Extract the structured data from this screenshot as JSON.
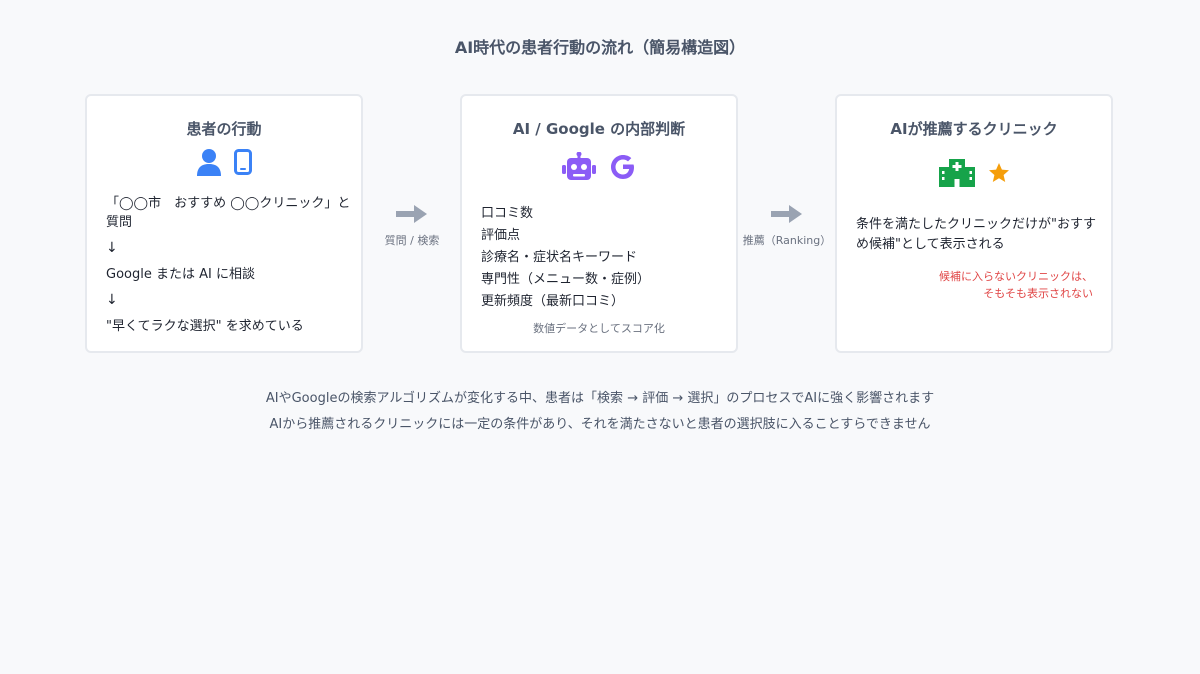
{
  "title": "AI時代の患者行動の流れ（簡易構造図）",
  "colors": {
    "blue_icon": "#3b82f6",
    "purple_icon": "#8b5cf6",
    "green_icon": "#16a34a",
    "star": "#f59e0b",
    "warning": "#e04646",
    "arrow": "#9aa3b2"
  },
  "card1": {
    "title": "患者の行動",
    "icons": [
      "person-icon",
      "smartphone-icon"
    ],
    "lines": [
      "「◯◯市　おすすめ ◯◯クリニック」と質問",
      "↓",
      "Google または AI に相談",
      "↓",
      "\"早くてラクな選択\" を求めている"
    ]
  },
  "arrow1": {
    "label": "質問 / 検索"
  },
  "card2": {
    "title": "AI / Google の内部判断",
    "icons": [
      "robot-icon",
      "google-g-icon"
    ],
    "items": [
      "口コミ数",
      "評価点",
      "診療名・症状名キーワード",
      "専門性（メニュー数・症例）",
      "更新頻度（最新口コミ）"
    ],
    "note": "数値データとしてスコア化"
  },
  "arrow2": {
    "label": "推薦（Ranking）"
  },
  "card3": {
    "title": "AIが推薦するクリニック",
    "icons": [
      "hospital-icon",
      "star-icon"
    ],
    "text": "条件を満たしたクリニックだけが\"おすすめ候補\"として表示される",
    "warning_line1": "候補に入らないクリニックは、",
    "warning_line2": "そもそも表示されない"
  },
  "footer": {
    "line1": "AIやGoogleの検索アルゴリズムが変化する中、患者は「検索 → 評価 → 選択」のプロセスでAIに強く影響されます",
    "line2": "AIから推薦されるクリニックには一定の条件があり、それを満たさないと患者の選択肢に入ることすらできません"
  }
}
